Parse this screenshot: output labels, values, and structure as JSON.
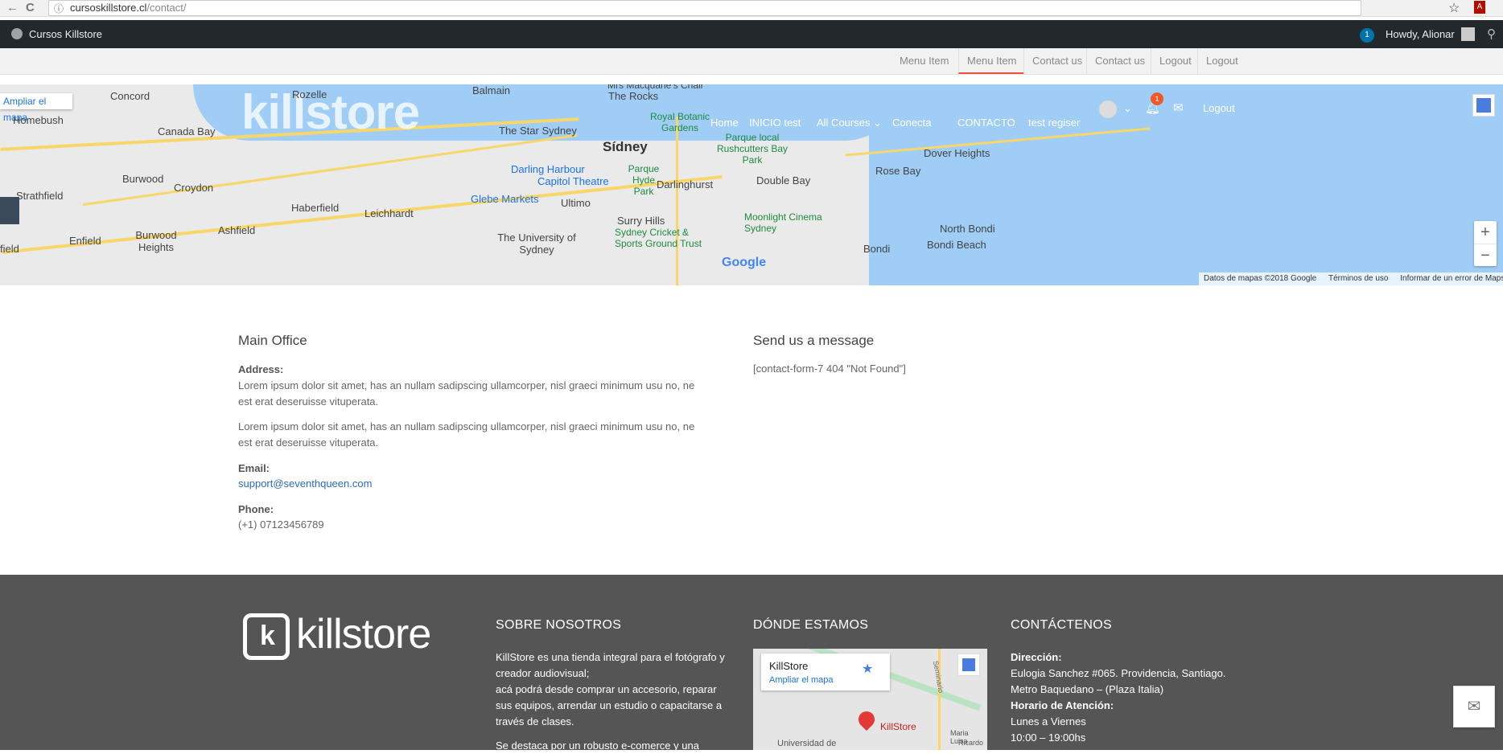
{
  "browser": {
    "url_host": "cursoskillstore.cl",
    "url_path": "/contact/",
    "back_icon": "←",
    "reload_icon": "C",
    "star_icon": "☆",
    "pdf_icon": "A"
  },
  "admin_bar": {
    "site_name": "Cursos Killstore",
    "notif_count": "1",
    "howdy": "Howdy, Alionar",
    "search_icon": "⚲"
  },
  "top_menu": {
    "items": [
      "Menu Item",
      "Menu Item",
      "Contact us",
      "Contact us",
      "Logout",
      "Logout"
    ],
    "active_index": 1
  },
  "map": {
    "open_link": "Ampliar el mapa",
    "logo_overlay": "killstore",
    "labels": {
      "concord": "Concord",
      "homebush": "Homebush",
      "canada_bay": "Canada Bay",
      "balmain": "Balmain",
      "rozelle": "Rozelle",
      "rocks": "The Rocks",
      "macquarie": "Mrs Macquarie's Chair",
      "botanic": "Royal Botanic Gardens",
      "star": "The Star Sydney",
      "sidney": "Sídney",
      "parque_local": "Parque local Rushcutters Bay Park",
      "darling_harbour": "Darling Harbour",
      "parque_hyde": "Parque Hyde Park",
      "darlinghurst": "Darlinghurst",
      "double_bay": "Double Bay",
      "capitol": "Capitol Theatre",
      "glebe": "Glebe Markets",
      "ultimo": "Ultimo",
      "rose_bay": "Rose Bay",
      "dover": "Dover Heights",
      "burwood": "Burwood",
      "croydon": "Croydon",
      "strathfield": "Strathfield",
      "haberfield": "Haberfield",
      "leichhardt": "Leichhardt",
      "surry": "Surry Hills",
      "moonlight": "Moonlight Cinema Sydney",
      "cricket": "Sydney Cricket & Sports Ground Trust",
      "uni": "The University of Sydney",
      "burwood_heights": "Burwood Heights",
      "enfield": "Enfield",
      "ashfield": "Ashfield",
      "north_bondi": "North Bondi",
      "bondi_beach": "Bondi Beach",
      "bondi": "Bondi",
      "field": "field",
      "google": "Google"
    },
    "attribution": [
      "Datos de mapas ©2018 Google",
      "Términos de uso",
      "Informar de un error de Maps"
    ],
    "zoom_in": "+",
    "zoom_out": "−"
  },
  "main_nav": {
    "items": [
      "Home",
      "INICIO test",
      "All Courses",
      "Conecta",
      "CONTACTO",
      "test regiser"
    ],
    "dropdown_arrow": "⌄",
    "notif_count": "1",
    "mail_icon": "✉",
    "logout": "Logout"
  },
  "office": {
    "heading": "Main Office",
    "address_label": "Address:",
    "address_1": "Lorem ipsum dolor sit amet, has an nullam sadipscing ullamcorper, nisl graeci minimum usu no, ne",
    "address_1b": "est erat deseruisse vituperata.",
    "address_2": "Lorem ipsum dolor sit amet, has an nullam sadipscing ullamcorper, nisl graeci minimum usu no, ne",
    "address_2b": "est erat deseruisse vituperata.",
    "email_label": "Email:",
    "email": "support@seventhqueen.com",
    "phone_label": "Phone:",
    "phone": "(+1) 07123456789"
  },
  "message": {
    "heading": "Send us a message",
    "form_text": "[contact-form-7 404 \"Not Found\"]"
  },
  "footer": {
    "logo_mark": "k",
    "logo_text": "killstore",
    "about": {
      "heading": "SOBRE NOSOTROS",
      "lines": [
        "KillStore es una tienda integral para el fotógrafo y",
        "creador audiovisual;",
        "acá podrá desde comprar un accesorio, reparar",
        "sus equipos, arrendar un estudio o capacitarse a",
        "través de clases.",
        "Se destaca por un robusto e-comerce y una"
      ]
    },
    "where": {
      "heading": "DÓNDE ESTAMOS",
      "card_title": "KillStore",
      "card_link": "Ampliar el mapa",
      "card_star": "★",
      "pin_label": "KillStore",
      "street_1": "Seminario",
      "street_2": "Universidad de",
      "street_3": "Maria Luisa",
      "street_4": "Ricardo"
    },
    "contact": {
      "heading": "CONTÁCTENOS",
      "dir_label": "Dirección:",
      "dir_1": "Eulogia Sanchez #065. Providencia, Santiago.",
      "dir_2": "Metro Baquedano – (Plaza Italia)",
      "hours_label": "Horario de Atención:",
      "hours_1": "Lunes a Viernes",
      "hours_2": "10:00 – 19:00hs"
    }
  },
  "message_button_icon": "✉"
}
